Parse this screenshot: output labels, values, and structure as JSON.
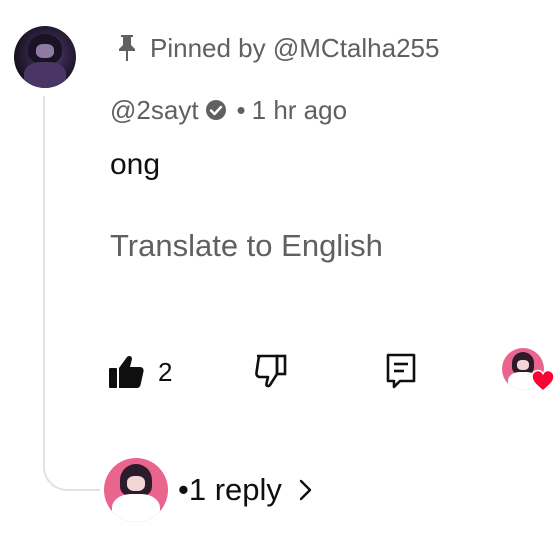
{
  "comment": {
    "pinned_text": "Pinned by @MCtalha255",
    "author": "@2sayt",
    "separator": "•",
    "time": "1 hr ago",
    "text": "ong",
    "translate_label": "Translate to English",
    "like_count": "2"
  },
  "replies": {
    "label": "•1 reply"
  },
  "colors": {
    "text_primary": "#0f0f0f",
    "text_secondary": "#606060",
    "heart": "#ff0033",
    "thread_line": "#e2e2e2"
  },
  "icons": {
    "pin": "pin-icon",
    "verified": "verified-check-icon",
    "like": "thumbs-up-filled-icon",
    "dislike": "thumbs-down-outline-icon",
    "reply": "comment-reply-icon",
    "heart": "creator-heart-icon",
    "chevron": "chevron-right-icon"
  }
}
